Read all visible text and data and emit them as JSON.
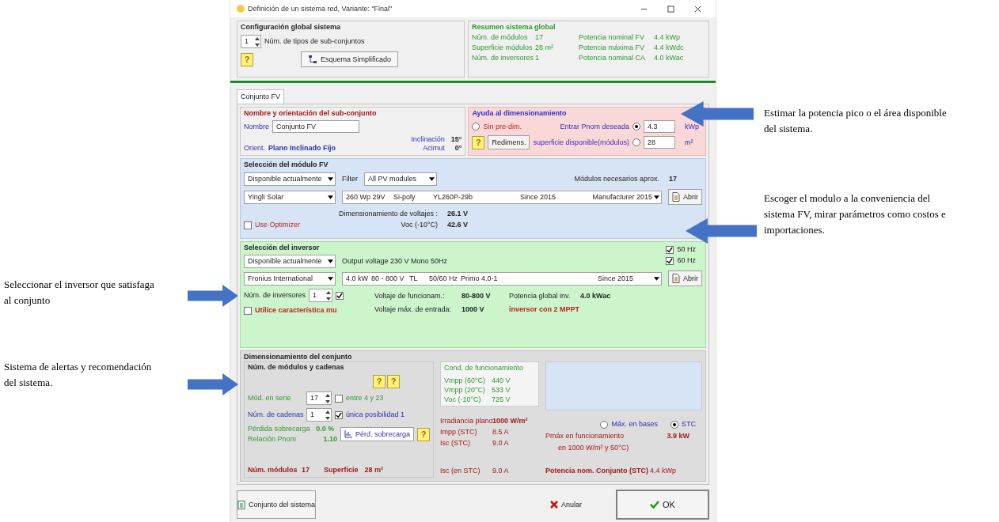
{
  "window": {
    "title": "Definición de un sistema red, Variante: \"Final\""
  },
  "global_config": {
    "title": "Configuración global sistema",
    "count": "1",
    "count_label": "Núm. de tipos de sub-conjuntos",
    "help": "?",
    "scheme_button": "Esquema Simplificado"
  },
  "summary": {
    "title": "Resumen sistema global",
    "rows": [
      {
        "label": "Núm. de módulos",
        "value": "17",
        "label_2": "Potencia nominal FV",
        "value_2": "4.4 kWp"
      },
      {
        "label": "Superficie módulos",
        "value": "28 m²",
        "label_2": "Potencia máxima FV",
        "value_2": "4.4 kWdc"
      },
      {
        "label": "Núm. de inversores",
        "value": "1",
        "label_2": "Potencia nominal CA",
        "value_2": "4.0 kWac"
      }
    ]
  },
  "tabs": [
    {
      "label": "Conjunto FV",
      "selected": true
    }
  ],
  "subarray": {
    "title": "Nombre y orientación del sub-conjunto",
    "name_label": "Nombre",
    "name_value": "Conjunto FV",
    "orient_label": "Orient.",
    "orient_value": "Plano Inclinado Fijo",
    "tilt_label": "Inclinación",
    "tilt_value": "15°",
    "azimuth_label": "Acimut",
    "azimuth_value": "0°"
  },
  "sizing_help": {
    "title": "Ayuda al dimensionamiento",
    "options": [
      {
        "label": "Sin pre-dim.",
        "selected": false
      },
      {
        "label": "Entrar Pnom deseada",
        "selected": true,
        "value": "4.3",
        "unit": "kWp"
      },
      {
        "label": "superficie disponible(módulos)",
        "selected": false,
        "value": "28",
        "unit": "m²"
      }
    ],
    "help": "?",
    "button": "Redimens."
  },
  "module": {
    "title": "Selección del módulo FV",
    "availability": "Disponible actualmente",
    "filter_label": "Filter",
    "filter": "All PV modules",
    "needed_label": "Módulos necesarios aprox.",
    "needed_value": "17",
    "manufacturer": "Yingli Solar",
    "model": [
      "260 Wp 29V",
      "Si-poly",
      "YL260P-29b",
      "Since 2015",
      "Manufacturer 2015"
    ],
    "open_button": "Abrir",
    "voltage_label": "Dimensionamiento de voltajes :",
    "voltage_value": "26.1 V",
    "voc_label": "Voc (-10°C)",
    "voc_value": "42.6 V",
    "optimizer": {
      "label": "Use Optimizer",
      "checked": false
    }
  },
  "inverter": {
    "title": "Selección del inversor",
    "availability": "Disponible actualmente",
    "output": "Output voltage 230 V Mono 50Hz",
    "frequencies": [
      {
        "label": "50 Hz",
        "checked": true
      },
      {
        "label": "60 Hz",
        "checked": true
      }
    ],
    "manufacturer": "Fronius International",
    "model": [
      "4.0 kW",
      "80 - 800 V",
      "TL",
      "50/60 Hz",
      "Primo 4.0-1",
      "Since 2015"
    ],
    "open_button": "Abrir",
    "count_label": "Núm. de inversores",
    "count": "1",
    "count_checked": true,
    "mu": {
      "label": "Utilice característica mu",
      "checked": false
    },
    "stats": [
      {
        "label": "Voltaje de funcionam.:",
        "value": "80-800 V"
      },
      {
        "label": "Voltaje máx. de entrada:",
        "value": "1000 V"
      }
    ],
    "power_label": "Potencia global inv.",
    "power_value": "4.0 kWac",
    "note": "inversor con 2 MPPT"
  },
  "design": {
    "title": "Dimensionamiento del conjunto",
    "subtitle": "Núm. de módulos y cadenas",
    "helps": [
      "?",
      "?"
    ],
    "series_label": "Mód. en serie",
    "series_value": "17",
    "series_check": {
      "label": "entre 4 y 23",
      "checked": false
    },
    "strings_label": "Núm. de cadenas",
    "strings_value": "1",
    "strings_check": {
      "label": "única posibilidad 1",
      "checked": true
    },
    "overload_label": "Pérdida sobrecarga",
    "overload_value": "0.0 %",
    "ratio_label": "Relación Pnom",
    "ratio_value": "1.10",
    "overload_button": "Pérd. sobrecarga",
    "overload_help": "?",
    "modules_label": "Núm. módulos",
    "modules_value": "17",
    "area_label": "Superficie",
    "area_value": "28 m²",
    "conditions": {
      "title": "Cond. de funcionamiento",
      "rows": [
        {
          "label": "Vmpp (60°C)",
          "value": "440 V"
        },
        {
          "label": "Vmpp (20°C)",
          "value": "533 V"
        },
        {
          "label": "Voc (-10°C)",
          "value": "725 V"
        }
      ]
    },
    "irradiance_label": "Irradiancia plano",
    "irradiance_value": "1000 W/m²",
    "currents": [
      {
        "label": "Impp (STC)",
        "value": "8.5 A"
      },
      {
        "label": "Isc (STC)",
        "value": "9.0 A"
      }
    ],
    "isc_label": "Isc (en STC)",
    "isc_value": "9.0 A",
    "modes": [
      {
        "label": "Máx. en bases",
        "selected": false
      },
      {
        "label": "STC",
        "selected": true
      }
    ],
    "pmax_label": "Pmáx en funcionamiento",
    "pmax_value": "3.9 kW",
    "pmax_note": "en 1000 W/m² y 50°C)",
    "nominal_label": "Potencia nom. Conjunto (STC)",
    "nominal_value": "4.4 kWp"
  },
  "footer": {
    "system_button": "Conjunto del sistema",
    "cancel_button": "Anular",
    "ok_button": "OK"
  },
  "annotations_right": [
    {
      "text": "Estimar  la potencia pico o el área disponible  del sistema."
    },
    {
      "text": "Escoger el modulo  a la conveniencia del sistema FV, mirar parámetros como costos e importaciones."
    }
  ],
  "annotations_left": [
    {
      "text": "Seleccionar  el inversor  que satisfaga  al conjunto"
    },
    {
      "text": "Sistema  de alertas  y recomendación  del sistema."
    }
  ]
}
